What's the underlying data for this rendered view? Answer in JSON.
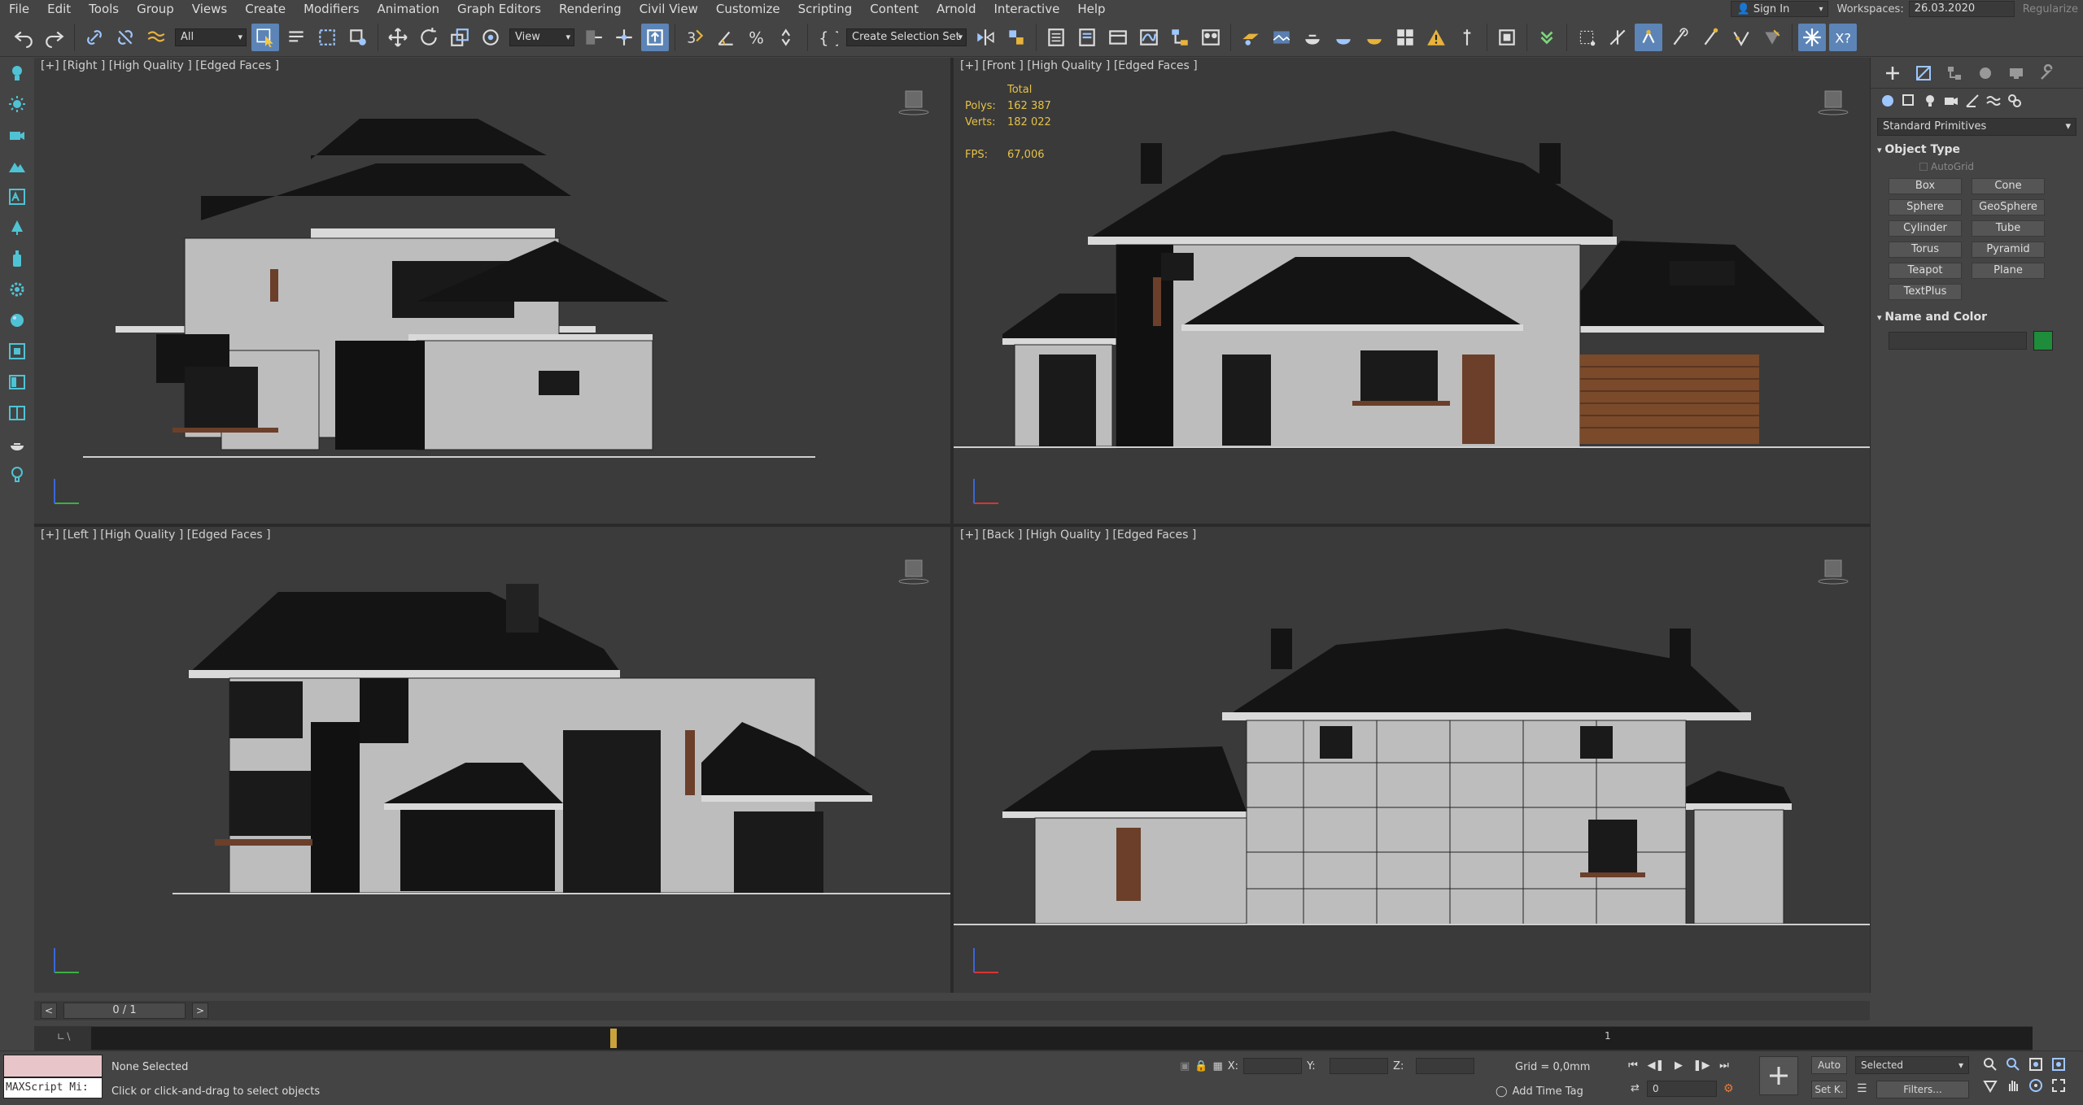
{
  "menu": [
    "File",
    "Edit",
    "Tools",
    "Group",
    "Views",
    "Create",
    "Modifiers",
    "Animation",
    "Graph Editors",
    "Rendering",
    "Civil View",
    "Customize",
    "Scripting",
    "Content",
    "Arnold",
    "Interactive",
    "Help"
  ],
  "header": {
    "sign_in": "Sign In",
    "workspaces_label": "Workspaces:",
    "workspaces_value": "26.03.2020",
    "regularize": "Regularize"
  },
  "toolbar": {
    "filter_value": "All",
    "ref_coord_value": "View",
    "selection_set_value": "Create Selection Set"
  },
  "viewports": {
    "right": {
      "label": "[+] [Right ] [High Quality ] [Edged Faces ]"
    },
    "front": {
      "label": "[+] [Front ] [High Quality ] [Edged Faces ]"
    },
    "left": {
      "label": "[+] [Left ] [High Quality ] [Edged Faces ]"
    },
    "back": {
      "label": "[+] [Back ] [High Quality ] [Edged Faces ]"
    }
  },
  "stats": {
    "total_label": "Total",
    "polys_label": "Polys:",
    "polys_value": "162 387",
    "verts_label": "Verts:",
    "verts_value": "182 022",
    "fps_label": "FPS:",
    "fps_value": "67,006"
  },
  "command_panel": {
    "category": "Standard Primitives",
    "object_type_title": "Object Type",
    "autogrid": "AutoGrid",
    "primitives": [
      "Box",
      "Cone",
      "Sphere",
      "GeoSphere",
      "Cylinder",
      "Tube",
      "Torus",
      "Pyramid",
      "Teapot",
      "Plane",
      "TextPlus"
    ],
    "name_color_title": "Name and Color",
    "object_color": "#1e8c3a"
  },
  "time_slider": {
    "prev": "<",
    "position": "0 / 1",
    "next": ">"
  },
  "trackbar": {
    "tick_label": "1"
  },
  "status": {
    "maxscript": "MAXScript Mi:",
    "selection": "None Selected",
    "prompt": "Click or click-and-drag to select objects",
    "x_label": "X:",
    "y_label": "Y:",
    "z_label": "Z:",
    "grid": "Grid = 0,0mm",
    "add_time_tag": "Add Time Tag",
    "frame": "0",
    "auto_key": "Auto",
    "set_key": "Set K.",
    "selected_value": "Selected",
    "filters": "Filters..."
  },
  "colors": {
    "accent": "#5c84b6",
    "active_viewport": "#d4a017",
    "stats_text": "#e5c247",
    "time_key": "#caa33c"
  }
}
